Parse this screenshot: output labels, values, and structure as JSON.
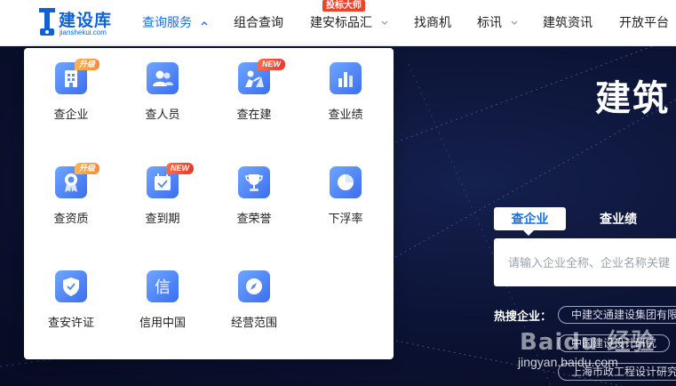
{
  "brand": {
    "name": "建设库",
    "domain": "jianshekui.com",
    "color": "#0d63d6"
  },
  "nav": {
    "items": [
      {
        "label": "查询服务",
        "active": true,
        "has_dropdown": true
      },
      {
        "label": "组合查询",
        "active": false,
        "has_dropdown": false
      },
      {
        "label": "建安标品汇",
        "active": false,
        "has_dropdown": true,
        "badge": "投标大师"
      },
      {
        "label": "找商机",
        "active": false,
        "has_dropdown": false
      },
      {
        "label": "标讯",
        "active": false,
        "has_dropdown": true
      },
      {
        "label": "建筑资讯",
        "active": false,
        "has_dropdown": false
      },
      {
        "label": "开放平台",
        "active": false,
        "has_dropdown": false
      }
    ]
  },
  "dropdown": {
    "items": [
      {
        "label": "查企业",
        "icon": "building-icon",
        "badge": "升级",
        "badge_type": "up"
      },
      {
        "label": "查人员",
        "icon": "people-icon",
        "badge": "",
        "badge_type": ""
      },
      {
        "label": "查在建",
        "icon": "construction-worker-icon",
        "badge": "NEW",
        "badge_type": "new"
      },
      {
        "label": "查业绩",
        "icon": "bar-chart-icon",
        "badge": "",
        "badge_type": ""
      },
      {
        "label": "查资质",
        "icon": "certificate-ribbon-icon",
        "badge": "升级",
        "badge_type": "up"
      },
      {
        "label": "查到期",
        "icon": "calendar-check-icon",
        "badge": "NEW",
        "badge_type": "new"
      },
      {
        "label": "查荣誉",
        "icon": "trophy-icon",
        "badge": "",
        "badge_type": ""
      },
      {
        "label": "下浮率",
        "icon": "pie-chart-icon",
        "badge": "",
        "badge_type": ""
      },
      {
        "label": "查安许证",
        "icon": "shield-check-icon",
        "badge": "",
        "badge_type": ""
      },
      {
        "label": "信用中国",
        "icon": "credit-icon",
        "badge": "",
        "badge_type": ""
      },
      {
        "label": "经营范围",
        "icon": "compass-icon",
        "badge": "",
        "badge_type": ""
      }
    ]
  },
  "hero": {
    "title": "建筑",
    "search_tabs": [
      {
        "label": "查企业",
        "active": true
      },
      {
        "label": "查业绩",
        "active": false
      }
    ],
    "search_placeholder": "请输入企业全称、企业名称关键",
    "hot_label": "热搜企业：",
    "hot_tags": [
      "中建交通建设集团有限",
      "中国建设设计研究",
      "上海市政工程设计研究"
    ],
    "watermark": "Baidu 经验",
    "watermark_url": "jingyan.baidu.com"
  },
  "colors": {
    "accent": "#1a6fe0",
    "hero_bg": "#0b1232",
    "badge_red": "#e8452c",
    "badge_orange": "#ff8a2b"
  }
}
